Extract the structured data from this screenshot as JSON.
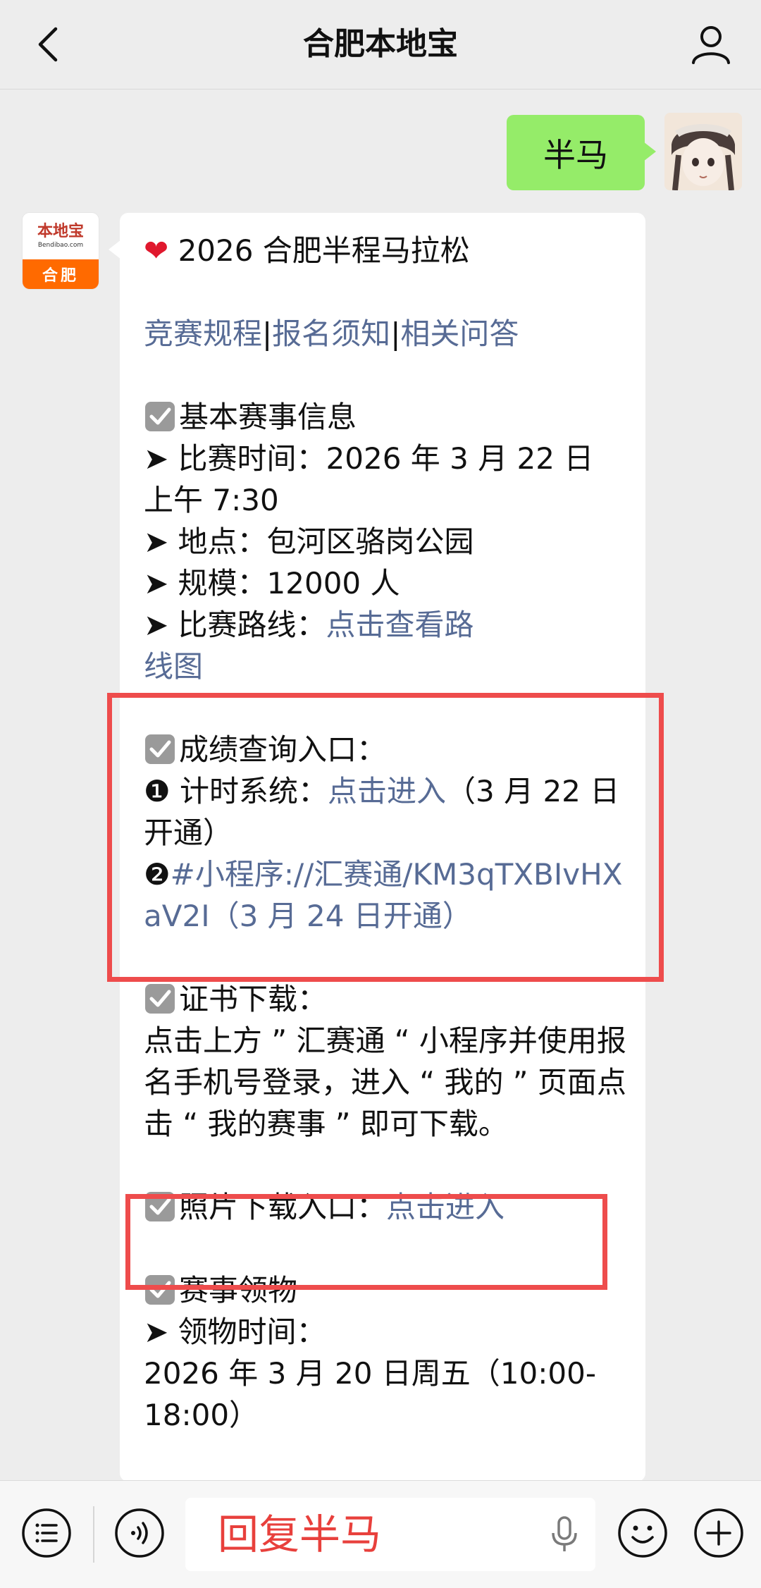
{
  "header": {
    "title": "合肥本地宝"
  },
  "conversation": {
    "user_message": "半马",
    "bot_avatar": {
      "logo_text": "本地宝",
      "logo_sub": "Bendibao.com",
      "city": "合肥"
    },
    "bot_message": {
      "title": "2026 合肥半程马拉松",
      "links": [
        "竞赛规程",
        "报名须知",
        "相关问答"
      ],
      "link_sep": "|",
      "basic_info": {
        "heading": "基本赛事信息",
        "time": "➤ 比赛时间：2026 年 3 月 22 日 上午 7:30",
        "location": "➤ 地点：包河区骆岗公园",
        "scale": "➤ 规模：12000 人",
        "route_label": "➤ 比赛路线：",
        "route_link": "点击查看路线图"
      },
      "results": {
        "heading": "成绩查询入口：",
        "item1_prefix": "❶ 计时系统：",
        "item1_link": "点击进入",
        "item1_note": "（3 月 22 日开通）",
        "item2_prefix": "❷",
        "item2_link": "#小程序://汇赛通/KM3qTXBIvHXaV2I（3 月 24 日开通）"
      },
      "certificate": {
        "heading": "证书下载：",
        "text": "点击上方 ” 汇赛通 “ 小程序并使用报名手机号登录，进入 “ 我的 ” 页面点击 “ 我的赛事 ” 即可下载。"
      },
      "photos": {
        "label": "照片下载入口：",
        "link": "点击进入"
      },
      "pickup": {
        "heading": "赛事领物",
        "time_label": "➤ 领物时间：",
        "time_value": "2026 年 3 月 20 日周五（10:00-18:00）"
      }
    }
  },
  "input_bar": {
    "text": "回复半马"
  },
  "colors": {
    "background": "#ededed",
    "user_bubble": "#95ec69",
    "link": "#576b95",
    "highlight": "#ee4c4c",
    "input_text": "#e8403c"
  }
}
